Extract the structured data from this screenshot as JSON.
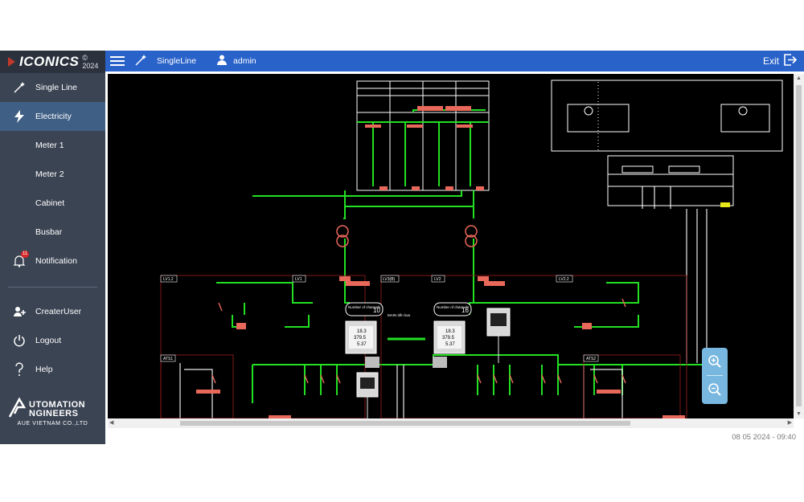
{
  "brand": {
    "name": "ICONICS",
    "year": "© 2024"
  },
  "sidebar": {
    "items": [
      {
        "label": "Single Line",
        "icon": "wand-icon"
      },
      {
        "label": "Electricity",
        "icon": "lightning-icon"
      },
      {
        "label": "Meter 1"
      },
      {
        "label": "Meter 2"
      },
      {
        "label": "Cabinet"
      },
      {
        "label": "Busbar"
      },
      {
        "label": "Notification",
        "icon": "bell-icon",
        "badge": "11"
      }
    ],
    "bottom_items": [
      {
        "label": "CreaterUser",
        "icon": "add-user-icon"
      },
      {
        "label": "Logout",
        "icon": "power-icon"
      },
      {
        "label": "Help",
        "icon": "question-icon"
      }
    ],
    "footer": {
      "line1": "UTOMATION",
      "line2": "NGINEERS",
      "company": "AUE VIETNAM CO.,LTD"
    }
  },
  "topbar": {
    "title": "SingleLine",
    "user": "admin",
    "exit_label": "Exit"
  },
  "diagram": {
    "panels": [
      "LV1.2",
      "LV1",
      "LV3(B)",
      "LV2",
      "LV2.2",
      "ATS1",
      "ATS2"
    ],
    "counters": [
      {
        "label": "Number of channels",
        "value": "10"
      },
      {
        "label": "Number of channels",
        "value": "16"
      }
    ],
    "meters": [
      {
        "values": [
          "18.3",
          "379.5",
          "5.37"
        ]
      },
      {
        "values": [
          "18.3",
          "379.5",
          "5.37"
        ]
      }
    ],
    "tie_label": "MAIN tiến bus"
  },
  "status": {
    "timestamp": "08 05 2024 - 09:40"
  },
  "colors": {
    "sidebar_bg": "#3b4453",
    "topbar_bg": "#2962c9",
    "active_bg": "#3f5f85",
    "bus_green": "#22e022",
    "breaker_red": "#e8685a",
    "zoom_bg": "#78b7e0"
  }
}
